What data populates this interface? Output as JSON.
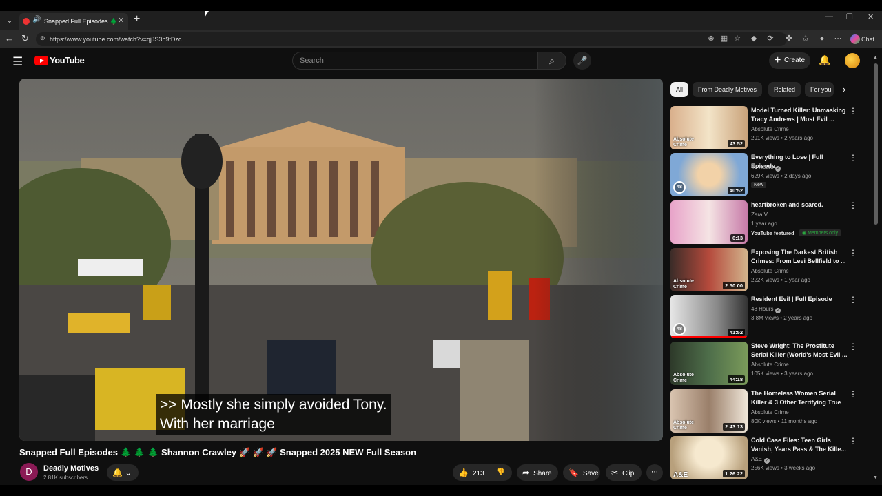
{
  "browser": {
    "tab_title": "Snapped Full Episodes 🌲 🌲",
    "url": "https://www.youtube.com/watch?v=qjJS3b9tDzc",
    "copilot_label": "Chat"
  },
  "yt_header": {
    "logo_text": "YouTube",
    "search_placeholder": "Search",
    "create_label": "Create"
  },
  "player": {
    "caption_line1": ">> Mostly she simply avoided Tony.",
    "caption_line2": "With her marriage"
  },
  "video": {
    "title": "Snapped Full Episodes 🌲 🌲 🌲 Shannon Crawley 🚀 🚀 🚀 Snapped 2025 NEW Full Season",
    "channel_initial": "D",
    "channel_name": "Deadly Motives",
    "subscribers": "2.81K subscribers",
    "likes": "213",
    "share_label": "Share",
    "save_label": "Save",
    "clip_label": "Clip"
  },
  "chips": [
    "All",
    "From Deadly Motives",
    "Related",
    "For you"
  ],
  "recommendations": [
    {
      "title": "Model Turned Killer: Unmasking Tracy Andrews | Most Evil ...",
      "channel": "Absolute Crime",
      "meta": "291K views • 2 years ago",
      "duration": "43:52",
      "thumb_color": "#c9a27a"
    },
    {
      "title": "Everything to Lose | Full Episode",
      "channel": "48 Hours",
      "meta": "629K views • 2 days ago",
      "duration": "40:52",
      "badge": "New",
      "thumb_color": "#7fa8d6"
    },
    {
      "title": "heartbroken and scared.",
      "channel": "Zara V",
      "meta": "1 year ago",
      "duration": "6:13",
      "featured": "YouTube featured",
      "members": "Members only",
      "thumb_color": "#c77aa8"
    },
    {
      "title": "Exposing The Darkest British Crimes: From Levi Bellfield to ...",
      "channel": "Absolute Crime",
      "meta": "222K views • 1 year ago",
      "duration": "2:50:00",
      "thumb_color": "#b54a3c"
    },
    {
      "title": "Resident Evil | Full Episode",
      "channel": "48 Hours",
      "meta": "3.8M views • 2 years ago",
      "duration": "41:52",
      "thumb_color": "#8a8a8a"
    },
    {
      "title": "Steve Wright: The Prostitute Serial Killer (World's Most Evil ...",
      "channel": "Absolute Crime",
      "meta": "105K views • 3 years ago",
      "duration": "44:18",
      "thumb_color": "#4e6e4a"
    },
    {
      "title": "The Homeless Women Serial Killer & 3 Other Terrifying True ...",
      "channel": "Absolute Crime",
      "meta": "80K views • 11 months ago",
      "duration": "2:43:13",
      "thumb_color": "#9a7f6a"
    },
    {
      "title": "Cold Case Files: Teen Girls Vanish, Years Pass & The Kille...",
      "channel": "A&E",
      "meta": "256K views • 3 weeks ago",
      "duration": "1:26:22",
      "thumb_color": "#d8c7a8"
    }
  ]
}
